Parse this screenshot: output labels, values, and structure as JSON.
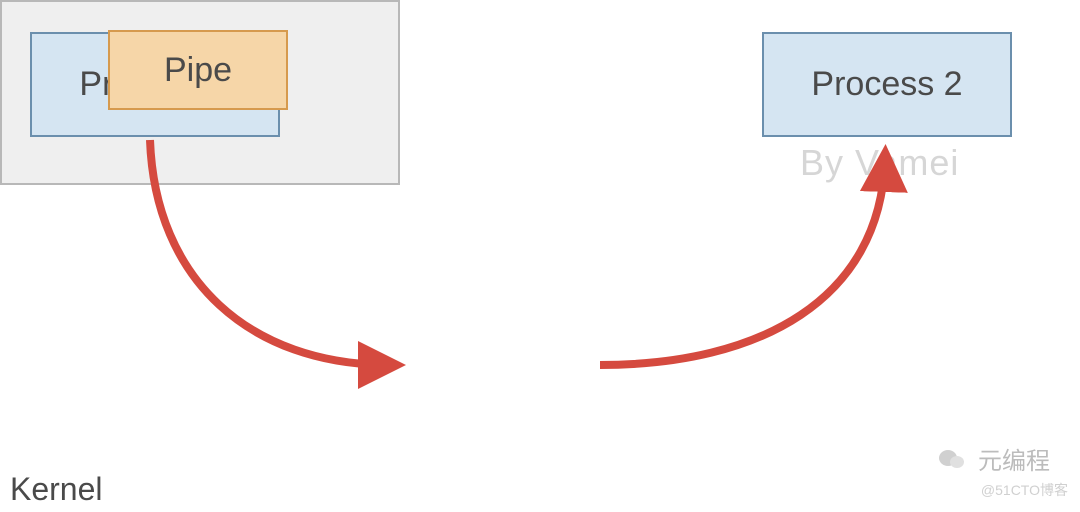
{
  "diagram": {
    "process1": {
      "label": "Process 1"
    },
    "process2": {
      "label": "Process 2"
    },
    "kernel": {
      "label": "Kernel"
    },
    "pipe": {
      "label": "Pipe"
    }
  },
  "watermarks": {
    "by_vamei": "By Vamei",
    "yuanbiancheng": "元编程",
    "blog51cto": "@51CTO博客"
  },
  "colors": {
    "process_fill": "#d5e5f2",
    "process_border": "#6b8fad",
    "kernel_fill": "#efefef",
    "kernel_border": "#b8b8b8",
    "pipe_fill": "#f6d6a8",
    "pipe_border": "#d69a4e",
    "arrow": "#d54a3f"
  }
}
